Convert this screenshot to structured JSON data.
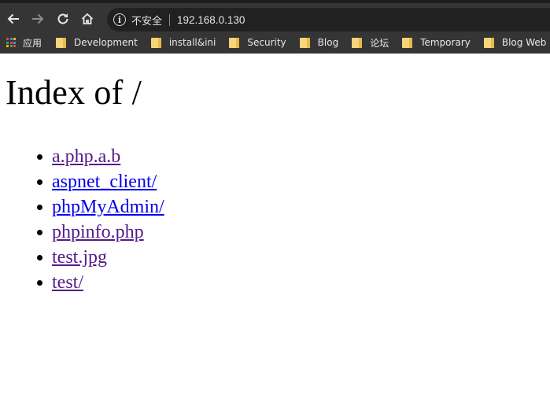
{
  "browser": {
    "security_label": "不安全",
    "url": "192.168.0.130"
  },
  "bookmarks": {
    "apps_label": "应用",
    "items": [
      {
        "label": "Development"
      },
      {
        "label": "install&ini"
      },
      {
        "label": "Security"
      },
      {
        "label": "Blog"
      },
      {
        "label": "论坛"
      },
      {
        "label": "Temporary"
      },
      {
        "label": "Blog Web"
      }
    ]
  },
  "page": {
    "title": "Index of /",
    "entries": [
      {
        "name": "a.php.a.b",
        "state": "visited"
      },
      {
        "name": "aspnet_client/",
        "state": "unvisited"
      },
      {
        "name": "phpMyAdmin/",
        "state": "unvisited"
      },
      {
        "name": "phpinfo.php",
        "state": "visited"
      },
      {
        "name": "test.jpg",
        "state": "visited"
      },
      {
        "name": "test/",
        "state": "visited"
      }
    ]
  },
  "colors": {
    "visited_link": "#551a8b",
    "unvisited_link": "#0000ee",
    "toolbar_bg": "#353535",
    "omnibox_bg": "#212121"
  },
  "icons": [
    "back-arrow-icon",
    "forward-arrow-icon",
    "reload-icon",
    "home-icon",
    "info-icon",
    "apps-grid-icon",
    "folder-icon"
  ]
}
